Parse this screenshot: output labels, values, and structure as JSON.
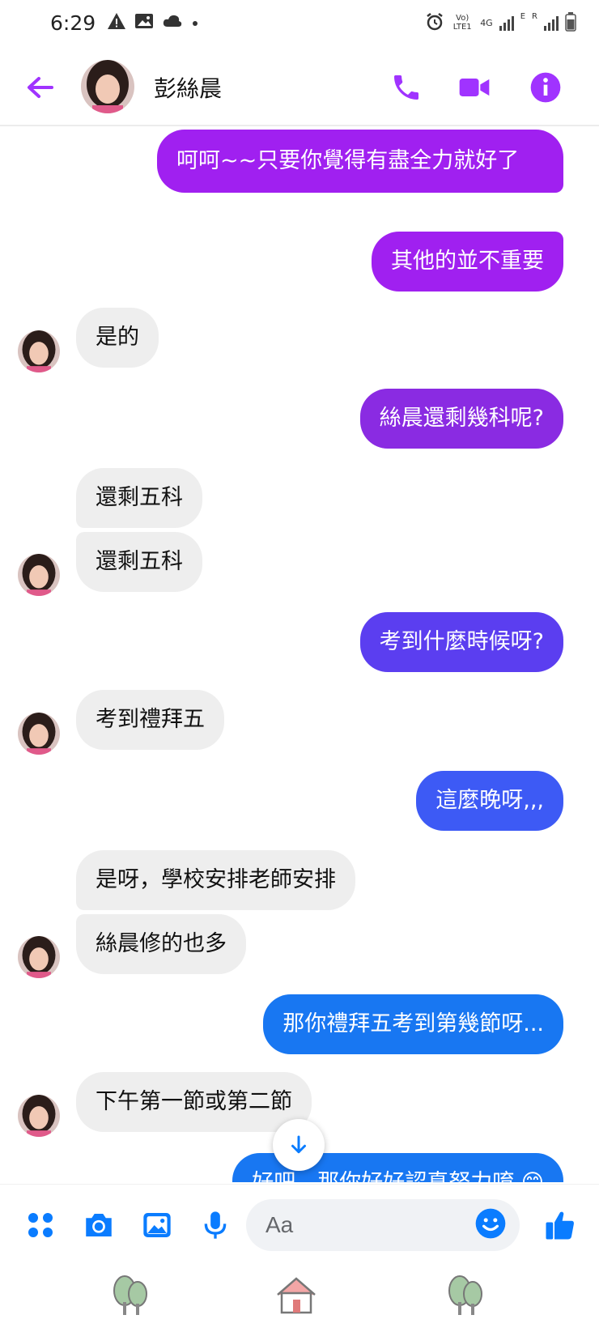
{
  "status_bar": {
    "time": "6:29",
    "network_label": "Vo) LTE1",
    "data_label": "4G",
    "sim2_label": "E",
    "roaming_label": "R"
  },
  "header": {
    "contact_name": "彭絲晨",
    "accent_color": "#a033ff"
  },
  "messages": [
    {
      "sender": "me",
      "text": "呵呵~~只要你覺得有盡全力就好了",
      "color": "#a020f0"
    },
    {
      "sender": "me",
      "text": "其他的並不重要",
      "color": "#a020f0"
    },
    {
      "sender": "contact",
      "text": "是的"
    },
    {
      "sender": "me",
      "text": "絲晨還剩幾科呢?",
      "color": "#8a2be2"
    },
    {
      "sender": "contact",
      "text": "還剩五科"
    },
    {
      "sender": "contact",
      "text": "還剩五科"
    },
    {
      "sender": "me",
      "text": "考到什麼時候呀?",
      "color": "#5b3ef0"
    },
    {
      "sender": "contact",
      "text": "考到禮拜五"
    },
    {
      "sender": "me",
      "text": "這麼晚呀,,,",
      "color": "#3d5af5"
    },
    {
      "sender": "contact",
      "text": "是呀，學校安排老師安排"
    },
    {
      "sender": "contact",
      "text": "絲晨修的也多"
    },
    {
      "sender": "me",
      "text": "那你禮拜五考到第幾節呀...",
      "color": "#1877f2"
    },
    {
      "sender": "contact",
      "text": "下午第一節或第二節"
    },
    {
      "sender": "me",
      "text": "好吧，那你好好認真努力唷 😊",
      "color": "#1877f2"
    }
  ],
  "composer": {
    "placeholder": "Aa",
    "icon_color": "#0a7cff"
  }
}
